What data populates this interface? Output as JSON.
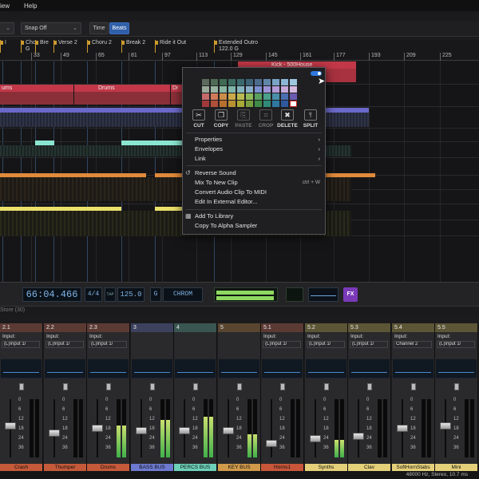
{
  "menu": {
    "items": [
      "iew",
      "Help"
    ]
  },
  "toolbar": {
    "grid_dropdown_value": "",
    "snap_label": "Snap Off",
    "time_label": "Time",
    "beats_label": "Beats"
  },
  "markers": [
    {
      "label": "I"
    },
    {
      "label": "Cho G"
    },
    {
      "label": "Bre"
    },
    {
      "label": "Verse 2"
    },
    {
      "label": "Choru 2"
    },
    {
      "label": "Break 2"
    },
    {
      "label": "Ride it Out"
    },
    {
      "label": "Extended Outro 122.0 G"
    }
  ],
  "ruler": {
    "ticks": [
      "33",
      "49",
      "65",
      "81",
      "97",
      "113",
      "129",
      "145",
      "161",
      "177",
      "193",
      "209",
      "225"
    ]
  },
  "clips": {
    "drums_label_1": "ums",
    "drums_label_2": "Drums",
    "drums_label_3": "Dr",
    "kick_label": "Kick - 500House"
  },
  "context_menu": {
    "toggle_on": true,
    "actions": [
      {
        "label": "CUT",
        "icon": "scissors-icon",
        "glyph": "✂",
        "enabled": true
      },
      {
        "label": "COPY",
        "icon": "copy-icon",
        "glyph": "❐",
        "enabled": true
      },
      {
        "label": "PASTE",
        "icon": "paste-icon",
        "glyph": "⎘",
        "enabled": false
      },
      {
        "label": "CROP",
        "icon": "crop-icon",
        "glyph": "⌗",
        "enabled": false
      },
      {
        "label": "DELETE",
        "icon": "trash-icon",
        "glyph": "✖",
        "enabled": true
      },
      {
        "label": "SPLIT",
        "icon": "split-icon",
        "glyph": "⫯",
        "enabled": true
      }
    ],
    "items": {
      "properties": "Properties",
      "envelopes": "Envelopes",
      "link": "Link",
      "reverse": "Reverse Sound",
      "mix_new": "Mix To New Clip",
      "mix_new_shortcut": "ctrl + W",
      "convert_midi": "Convert Audio Clip To MIDI",
      "edit_external": "Edit In External Editor...",
      "add_library": "Add To Library",
      "copy_alpha": "Copy To Alpha Sampler"
    },
    "swatch_colors": [
      "#5b6a5c",
      "#4f6b55",
      "#3f6a53",
      "#3b6b62",
      "#3b6a6e",
      "#3d6376",
      "#4a6b8c",
      "#5f86a8",
      "#7aa4c6",
      "#8db6d4",
      "#9ec6df",
      "#9aa79b",
      "#98b3a0",
      "#88b5a0",
      "#7fb5ab",
      "#84b4bd",
      "#8aaec9",
      "#7c8fcf",
      "#9c94d6",
      "#b39ad6",
      "#c4a8d8",
      "#d5b9df",
      "#c46a6a",
      "#d07a5a",
      "#c98d4a",
      "#c9a94a",
      "#b9bb52",
      "#8fba5a",
      "#5aa060",
      "#4aa08a",
      "#4a8fa8",
      "#4a6fb0",
      "#6a5ab0",
      "#a03a3a",
      "#b0503a",
      "#b86f2e",
      "#b89232",
      "#a8aa36",
      "#78a040",
      "#3f8a48",
      "#2f8a78",
      "#2f78a0",
      "#2f58a0",
      "#ffffff"
    ]
  },
  "transport": {
    "time": "66:04.466",
    "signature": "4/4",
    "tap": "TAP",
    "tempo": "125.0",
    "key": "G",
    "scale": "CHROM",
    "fx_label": "FX"
  },
  "playback_region_label": "Store (30)",
  "mixer": {
    "scale_marks": [
      "0",
      "6",
      "12",
      "18",
      "24",
      "36"
    ],
    "strips": [
      {
        "num": "2.1",
        "input_label": "Input:",
        "input": "(L)Input 1/",
        "name": "Crash",
        "color": "#c55a3a",
        "head": "#5c3a34",
        "fader": 0.55,
        "meter": 0.0
      },
      {
        "num": "2.2",
        "input_label": "Input:",
        "input": "(L)Input 1/",
        "name": "Thumper",
        "color": "#c55a3a",
        "head": "#5c3a34",
        "fader": 0.4,
        "meter": 0.0
      },
      {
        "num": "2.3",
        "input_label": "Input:",
        "input": "(L)Input 1/",
        "name": "Drums",
        "color": "#c55a3a",
        "head": "#5c3a34",
        "fader": 0.5,
        "meter": 0.55
      },
      {
        "num": "3",
        "input_label": "",
        "input": "",
        "name": "BASS BUS",
        "color": "#6d7ad0",
        "head": "#3c425e",
        "fader": 0.45,
        "meter": 0.65
      },
      {
        "num": "4",
        "input_label": "",
        "input": "",
        "name": "PERCS BUS",
        "color": "#6dd0b8",
        "head": "#3a5650",
        "fader": 0.45,
        "meter": 0.7
      },
      {
        "num": "5",
        "input_label": "",
        "input": "",
        "name": "KEY BUS",
        "color": "#d09a4a",
        "head": "#5a4630",
        "fader": 0.45,
        "meter": 0.4
      },
      {
        "num": "5.1",
        "input_label": "Input:",
        "input": "(L)Input 1/",
        "name": "Horns1",
        "color": "#c7563a",
        "head": "#5c3a34",
        "fader": 0.2,
        "meter": 0.0
      },
      {
        "num": "5.2",
        "input_label": "Input:",
        "input": "(L)Input 1/",
        "name": "Synths",
        "color": "#e5d07a",
        "head": "#5c5636",
        "fader": 0.3,
        "meter": 0.3
      },
      {
        "num": "5.3",
        "input_label": "Input:",
        "input": "(L)Input 1/",
        "name": "Clav",
        "color": "#e5d07a",
        "head": "#5c5636",
        "fader": 0.35,
        "meter": 0.0
      },
      {
        "num": "5.4",
        "input_label": "Input:",
        "input": "Channel 2",
        "name": "SoftHornStabs",
        "color": "#e5d07a",
        "head": "#5c5636",
        "fader": 0.5,
        "meter": 0.0
      },
      {
        "num": "5.5",
        "input_label": "Input:",
        "input": "(L)Input 1/",
        "name": "Mini",
        "color": "#e5d07a",
        "head": "#5c5636",
        "fader": 0.55,
        "meter": 0.0
      }
    ]
  },
  "status": {
    "text": "48000 Hz, Stereo, 10.7 ms"
  },
  "accent_colors": {
    "blue": "#2f5fa8",
    "purple": "#7a3ab8",
    "marker": "#cc9a2e"
  }
}
